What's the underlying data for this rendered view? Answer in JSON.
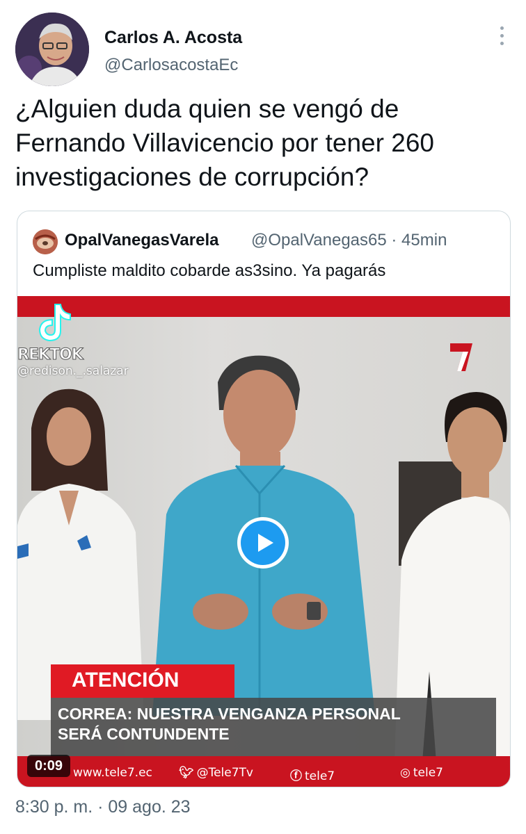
{
  "author": {
    "name": "Carlos A. Acosta",
    "handle": "@CarlosacostaEc"
  },
  "tweet": {
    "text_line1": "¿Alguien duda quien se vengó de",
    "text_line2": "Fernando Villavicencio por tener 260",
    "text_line3": "investigaciones de corrupción?"
  },
  "quoted_tweet": {
    "name": "OpalVanegasVarela",
    "handle_time": "@OpalVanegas65 · 45min",
    "text": "Cumpliste maldito cobarde as3sino.  Ya pagarás",
    "video": {
      "watermark_app": "REKTOK",
      "watermark_user": "@redison._.salazar",
      "banner": "ATENCIÓN",
      "headline_line1": "CORREA: NUESTRA VENGANZA PERSONAL",
      "headline_line2": "SERÁ CONTUNDENTE",
      "duration": "0:09",
      "footer": {
        "website": "www.tele7.ec",
        "twitter": "@Tele7Tv",
        "facebook": "tele7",
        "instagram": "tele7"
      },
      "channel_logo": "7"
    }
  },
  "timestamp": "8:30 p. m. · 09 ago. 23",
  "colors": {
    "accent": "#1d9bf0",
    "broadcast_red": "#c91420",
    "secondary_text": "#536471"
  }
}
